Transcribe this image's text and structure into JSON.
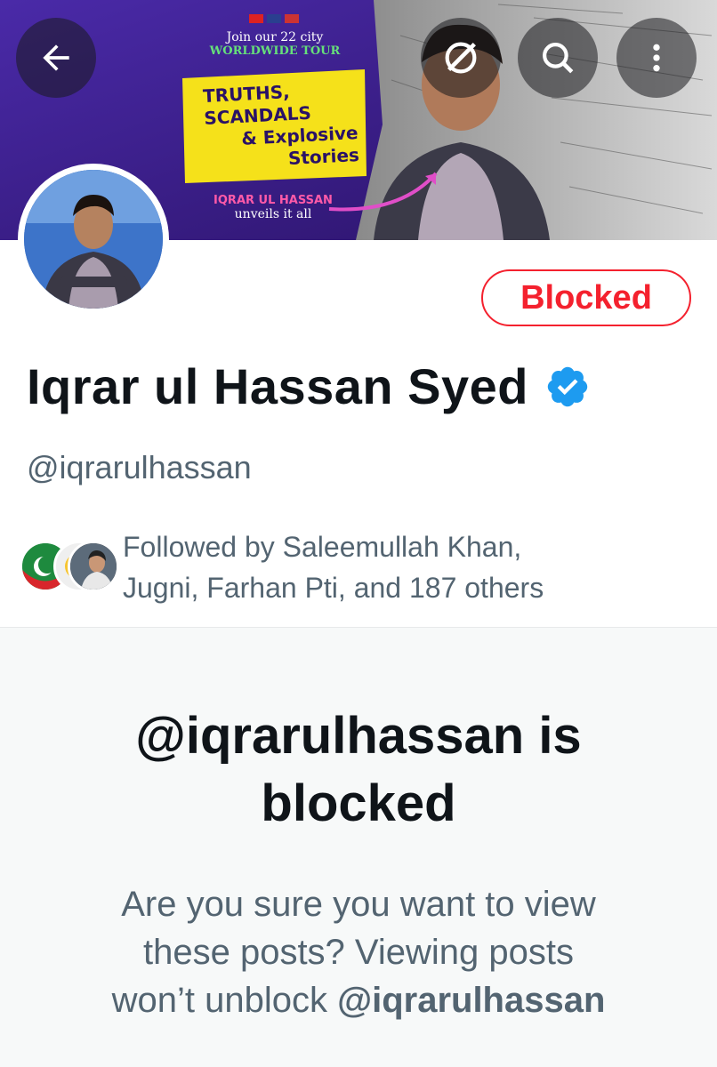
{
  "banner": {
    "tour_line1": "Join our 22 city",
    "tour_line2": "WORLDWIDE TOUR",
    "headline_line1": "TRUTHS,",
    "headline_line2": "SCANDALS",
    "headline_line3": "& Explosive",
    "headline_line4": "Stories",
    "name_caption": "IQRAR UL HASSAN",
    "unveils": "unveils it all"
  },
  "toolbar": {
    "back_icon": "back-arrow-icon",
    "grok_icon": "grok-icon",
    "search_icon": "search-icon",
    "more_icon": "more-vertical-icon"
  },
  "profile": {
    "blocked_label": "Blocked",
    "name": "Iqrar ul Hassan Syed",
    "handle": "@iqrarulhassan",
    "followed_by_line1": "Followed by Saleemullah Khan,",
    "followed_by_line2": "Jugni, Farhan Pti, and 187 others"
  },
  "blocked_notice": {
    "title_line1": "@iqrarulhassan is",
    "title_line2": "blocked",
    "text_line1": "Are you sure you want to view",
    "text_line2": "these posts? Viewing posts",
    "text_line3_prefix": "won’t unblock ",
    "text_line3_handle": "@iqrarulhassan"
  },
  "colors": {
    "accent_red": "#f4212e",
    "verified_blue": "#1d9bf0",
    "muted_text": "#536471",
    "banner_purple": "#3a1c8c"
  }
}
